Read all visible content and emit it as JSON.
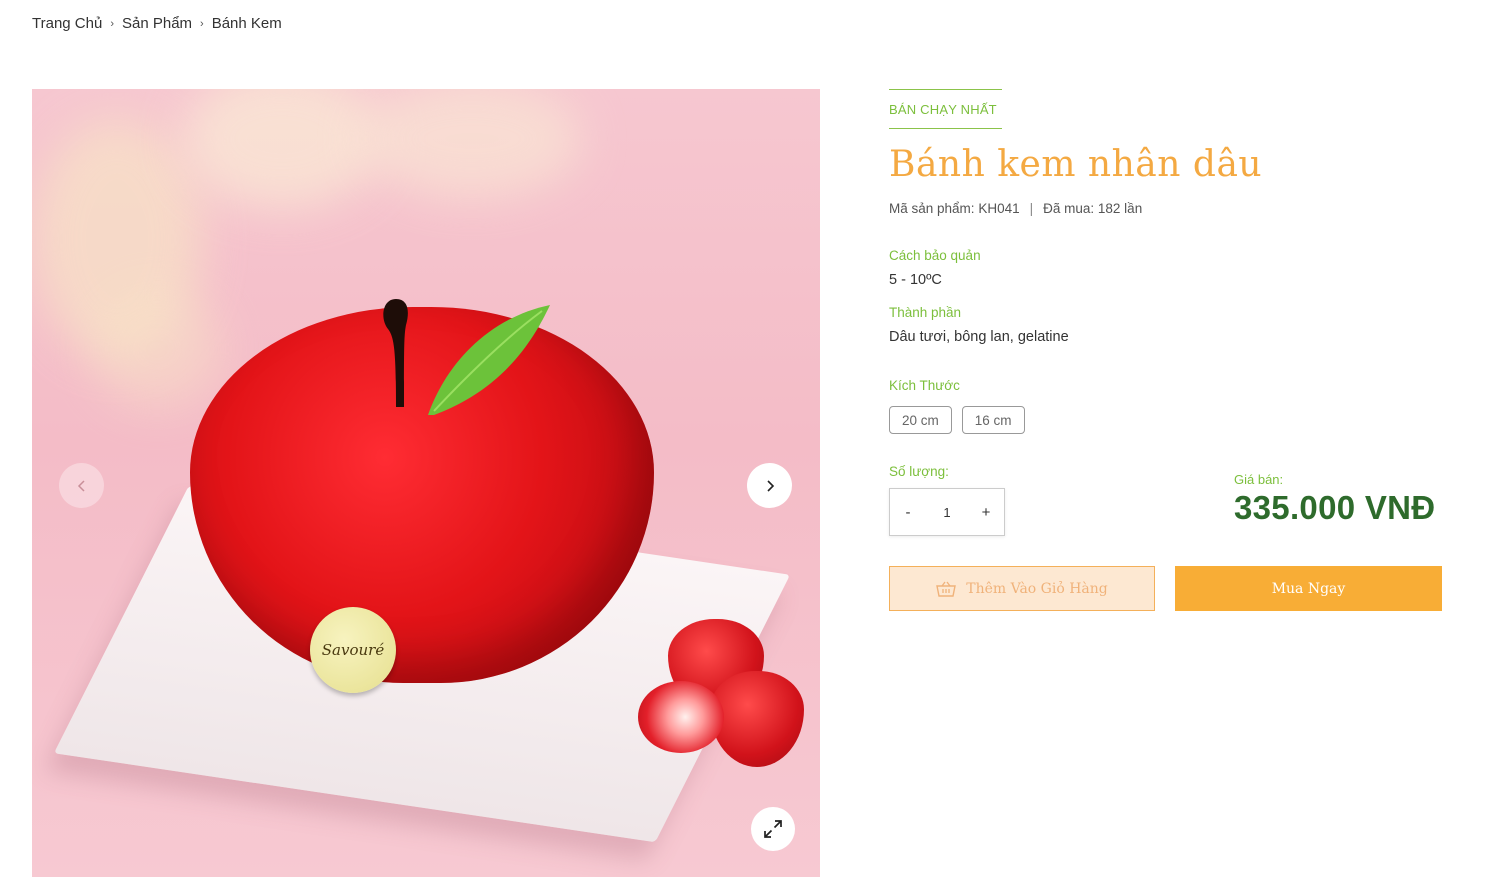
{
  "breadcrumb": {
    "items": [
      "Trang Chủ",
      "Sản Phẩm",
      "Bánh Kem"
    ],
    "separator": "›"
  },
  "gallery": {
    "logo_text": "Savouré",
    "prev_icon": "chevron-left-icon",
    "next_icon": "chevron-right-icon",
    "zoom_icon": "expand-icon"
  },
  "product": {
    "badge": "BÁN CHẠY NHẤT",
    "title": "Bánh kem nhân dâu",
    "sku_label": "Mã sản phẩm:",
    "sku": "KH041",
    "meta_separator": "|",
    "purchased_label": "Đã mua:",
    "purchased": "182 lần",
    "storage_label": "Cách bảo quản",
    "storage_value": "5 - 10ºC",
    "ingredients_label": "Thành phần",
    "ingredients_value": "Dâu tươi, bông lan, gelatine",
    "size_label": "Kích Thước",
    "sizes": [
      "20 cm",
      "16 cm"
    ],
    "quantity_label": "Số lượng:",
    "quantity_minus": "-",
    "quantity_value": "1",
    "quantity_plus": "+",
    "price_label": "Giá bán:",
    "price": "335.000 VNĐ",
    "add_to_cart_label": "Thêm Vào Giỏ Hàng",
    "cart_icon": "basket-icon",
    "buy_now_label": "Mua Ngay"
  },
  "colors": {
    "accent_orange": "#f8ad36",
    "title_orange": "#f4a942",
    "green_label": "#7cbf3c",
    "price_green": "#2e6b2c"
  }
}
